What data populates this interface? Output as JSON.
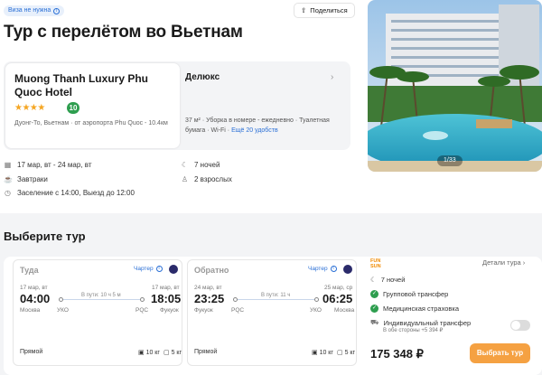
{
  "header": {
    "visa_badge": "Виза не нужна",
    "share_label": "Поделиться",
    "title": "Тур с перелётом во Вьетнам"
  },
  "hotel": {
    "name": "Muong Thanh Luxury Phu Quoc Hotel",
    "stars": "★★★★",
    "rating": "10",
    "location": "Дуонг-То, Вьетнам · от аэропорта Phu Quoc - 10.4км"
  },
  "room": {
    "name": "Делюкс",
    "description": "37 м² · Уборка в номере - ежедневно · Туалетная бумага · Wi-Fi ·",
    "more_link": "Ещё 20 удобств"
  },
  "trip_info": {
    "dates": "17 мар, вт - 24 мар, вт",
    "meals": "Завтраки",
    "checkin": "Заселение с 14:00, Выезд до 12:00",
    "nights": "7 ночей",
    "guests": "2 взрослых"
  },
  "photo": {
    "counter": "1/33"
  },
  "tour_section": {
    "title": "Выберите тур"
  },
  "flights": [
    {
      "label": "Туда",
      "charter": "Чартер",
      "dep_date": "17 мар, вт",
      "arr_date": "17 мар, вт",
      "dep_time": "04:00",
      "arr_time": "18:05",
      "duration": "В пути: 10 ч 5 м",
      "dep_code": "УКО",
      "arr_code": "PQC",
      "dep_city": "Москва",
      "arr_city": "Фукуок",
      "type": "Прямой",
      "baggage": "10 кг",
      "hand": "5 кг"
    },
    {
      "label": "Обратно",
      "charter": "Чартер",
      "dep_date": "24 мар, вт",
      "arr_date": "25 мар, ср",
      "dep_time": "23:25",
      "arr_time": "06:25",
      "duration": "В пути: 11 ч",
      "dep_code": "PQC",
      "arr_code": "УКО",
      "dep_city": "Фукуок",
      "arr_city": "Москва",
      "type": "Прямой",
      "baggage": "10 кг",
      "hand": "5 кг"
    }
  ],
  "offer": {
    "operator_line1": "FUN",
    "operator_line2": "SUN",
    "details_link": "Детали тура",
    "nights": "7 ночей",
    "transfer": "Групповой трансфер",
    "insurance": "Медицинская страховка",
    "individual_transfer": "Индивидуальный трансфер",
    "individual_price": "В обе стороны +5 394 ₽",
    "price": "175 348 ₽",
    "book_button": "Выбрать тур"
  },
  "colors": {
    "accent_orange": "#f5a142",
    "rating_green": "#2e9e4f",
    "link_blue": "#2a6fd6"
  }
}
